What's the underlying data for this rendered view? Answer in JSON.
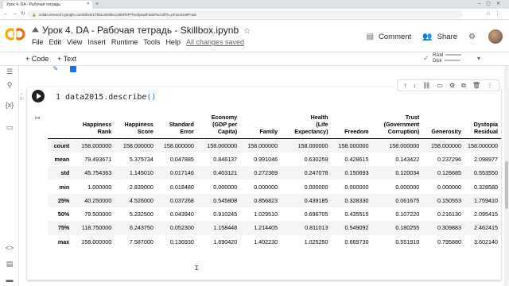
{
  "browser": {
    "tab_title": "Урок 4. DA - Рабочая тетрадь",
    "url": "colab.research.google.com/drive/1T8eLmE8leLnJ5hPbFFfnullyuwtFa8z#scrollTo=pF4ozDa6Poak"
  },
  "colab": {
    "logo_text": "CO",
    "doc_title": "Урок 4. DA - Рабочая тетрадь - Skillbox.ipynb",
    "menus": [
      "File",
      "Edit",
      "View",
      "Insert",
      "Runtime",
      "Tools",
      "Help"
    ],
    "save_status": "All changes saved",
    "comment_label": "Comment",
    "share_label": "Share"
  },
  "toolbar": {
    "code_label": "+ Code",
    "text_label": "+ Text",
    "ram_label": "RAM",
    "disk_label": "Disk"
  },
  "cell": {
    "line_number": "1",
    "code_text": "data2015.describe",
    "code_parens": "()"
  },
  "table": {
    "columns": [
      [
        "Happiness",
        "Rank"
      ],
      [
        "Happiness",
        "Score"
      ],
      [
        "Standard",
        "Error"
      ],
      [
        "Economy",
        "(GDP per",
        "Capita)"
      ],
      [
        "Family"
      ],
      [
        "Health",
        "(Life",
        "Expectancy)"
      ],
      [
        "Freedom"
      ],
      [
        "Trust",
        "(Government",
        "Corruption)"
      ],
      [
        "Generosity"
      ],
      [
        "Dystopia",
        "Residual"
      ]
    ],
    "rows": [
      {
        "label": "count",
        "values": [
          "158.000000",
          "158.000000",
          "158.000000",
          "158.000000",
          "158.000000",
          "158.000000",
          "158.000000",
          "158.000000",
          "158.000000",
          "158.000000"
        ]
      },
      {
        "label": "mean",
        "values": [
          "79.493671",
          "5.375734",
          "0.047885",
          "0.846137",
          "0.991046",
          "0.630259",
          "0.428615",
          "0.143422",
          "0.237296",
          "2.098977"
        ]
      },
      {
        "label": "std",
        "values": [
          "45.754363",
          "1.145010",
          "0.017146",
          "0.403121",
          "0.272369",
          "0.247078",
          "0.150693",
          "0.120034",
          "0.126685",
          "0.553550"
        ]
      },
      {
        "label": "min",
        "values": [
          "1.000000",
          "2.839000",
          "0.018480",
          "0.000000",
          "0.000000",
          "0.000000",
          "0.000000",
          "0.000000",
          "0.000000",
          "0.328580"
        ]
      },
      {
        "label": "25%",
        "values": [
          "40.250000",
          "4.526000",
          "0.037268",
          "0.545808",
          "0.856823",
          "0.439185",
          "0.328330",
          "0.061675",
          "0.150553",
          "1.759410"
        ]
      },
      {
        "label": "50%",
        "values": [
          "79.500000",
          "5.232500",
          "0.043940",
          "0.910245",
          "1.029510",
          "0.696705",
          "0.435515",
          "0.107220",
          "0.216130",
          "2.095415"
        ]
      },
      {
        "label": "75%",
        "values": [
          "118.750000",
          "6.243750",
          "0.052300",
          "1.158448",
          "1.214405",
          "0.811013",
          "0.549092",
          "0.180255",
          "0.309883",
          "2.462415"
        ]
      },
      {
        "label": "max",
        "values": [
          "158.000000",
          "7.587000",
          "0.136930",
          "1.690420",
          "1.402230",
          "1.025250",
          "0.669730",
          "0.551910",
          "0.795880",
          "3.602140"
        ]
      }
    ]
  },
  "icons": {
    "run": "play-icon",
    "magic": "magic-wand-icon",
    "chart": "bar-chart-icon",
    "output": "output-icon"
  }
}
